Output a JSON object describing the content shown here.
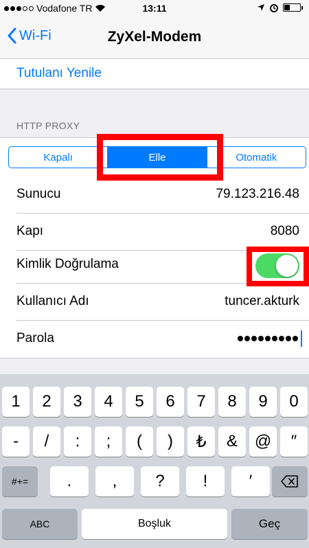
{
  "status": {
    "carrier": "Vodafone TR",
    "time": "13:11"
  },
  "nav": {
    "back_label": "Wi-Fi",
    "title": "ZyXel-Modem"
  },
  "refresh_label": "Tutulanı Yenile",
  "proxy": {
    "section_header": "HTTP PROXY",
    "segments": [
      "Kapalı",
      "Elle",
      "Otomatik"
    ],
    "selected_segment": "Elle",
    "server_label": "Sunucu",
    "server_value": "79.123.216.48",
    "port_label": "Kapı",
    "port_value": "8080",
    "auth_label": "Kimlik Doğrulama",
    "auth_enabled": true,
    "username_label": "Kullanıcı Adı",
    "username_value": "tuncer.akturk",
    "password_label": "Parola"
  },
  "keyboard": {
    "row1": [
      "1",
      "2",
      "3",
      "4",
      "5",
      "6",
      "7",
      "8",
      "9",
      "0"
    ],
    "row2": [
      "-",
      "/",
      ":",
      ";",
      "(",
      ")",
      "₺",
      "&",
      "@",
      "″"
    ],
    "row3": [
      ".",
      ",",
      "?",
      "!",
      "′"
    ],
    "symbols_key": "#+=",
    "abc_key": "ABC",
    "space_key": "Boşluk",
    "go_key": "Geç"
  },
  "colors": {
    "accent": "#007aff",
    "toggle_on": "#4cd964",
    "highlight": "#ff0000"
  }
}
